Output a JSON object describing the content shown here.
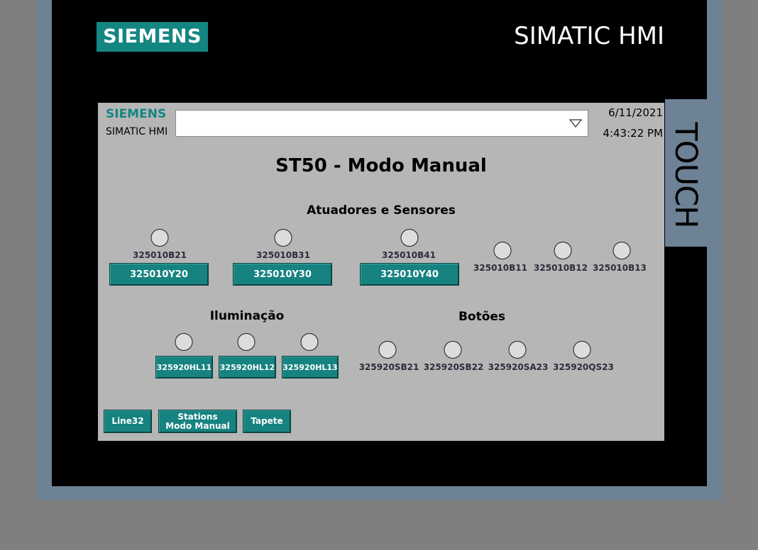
{
  "bezel": {
    "logo": "SIEMENS",
    "brand": "SIMATIC HMI",
    "touch": "TOUCH"
  },
  "header": {
    "siemens": "SIEMENS",
    "hmi": "SIMATIC HMI",
    "dropdown_value": "",
    "date": "6/11/2021",
    "time": "4:43:22 PM"
  },
  "title": "ST50 - Modo Manual",
  "sections": {
    "atuadores": "Atuadores e Sensores",
    "iluminacao": "Iluminação",
    "botoes": "Botões"
  },
  "atuadores": {
    "sensors_with_buttons": [
      {
        "sensor": "325010B21",
        "button": "325010Y20"
      },
      {
        "sensor": "325010B31",
        "button": "325010Y30"
      },
      {
        "sensor": "325010B41",
        "button": "325010Y40"
      }
    ],
    "sensors": [
      "325010B11",
      "325010B12",
      "325010B13"
    ]
  },
  "iluminacao": [
    "325920HL11",
    "325920HL12",
    "325920HL13"
  ],
  "botoes": [
    "325920SB21",
    "325920SB22",
    "325920SA23",
    "325920QS23"
  ],
  "nav": {
    "line32": "Line32",
    "stations_line1": "Stations",
    "stations_line2": "Modo Manual",
    "tapete": "Tapete"
  },
  "colors": {
    "brand_teal": "#148682",
    "button_teal": "#168380",
    "screen_bg": "#b6b6b6",
    "bezel": "#000000",
    "frame": "#6d8294"
  }
}
